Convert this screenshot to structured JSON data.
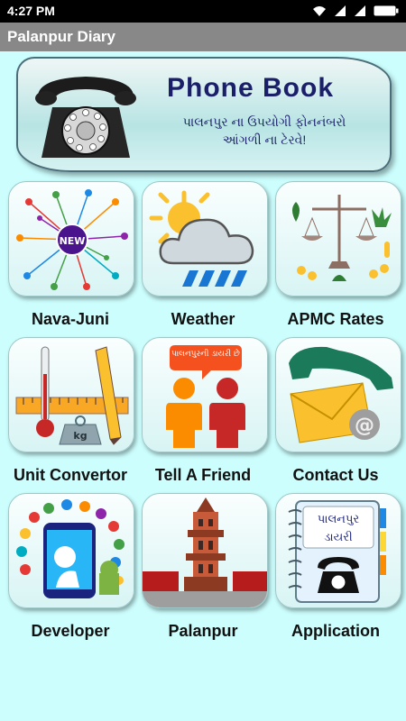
{
  "status": {
    "time": "4:27 PM"
  },
  "app_title": "Palanpur Diary",
  "phonebook": {
    "title": "Phone Book",
    "subtitle_line1": "પાલનપુર ના ઉપયોગી ફોનનંબરો",
    "subtitle_line2": "આંગળી ના ટેરવે!"
  },
  "tiles": [
    {
      "label": "Nava-Juni",
      "badge": "NEW"
    },
    {
      "label": "Weather"
    },
    {
      "label": "APMC Rates"
    },
    {
      "label": "Unit Convertor",
      "badge": "kg"
    },
    {
      "label": "Tell A Friend",
      "bubble": "પાલનપુરની ડાયરી છે"
    },
    {
      "label": "Contact Us",
      "badge": "@"
    },
    {
      "label": "Developer"
    },
    {
      "label": "Palanpur"
    },
    {
      "label": "Application",
      "card_line1": "પાલનપુર",
      "card_line2": "ડાયરી"
    }
  ]
}
